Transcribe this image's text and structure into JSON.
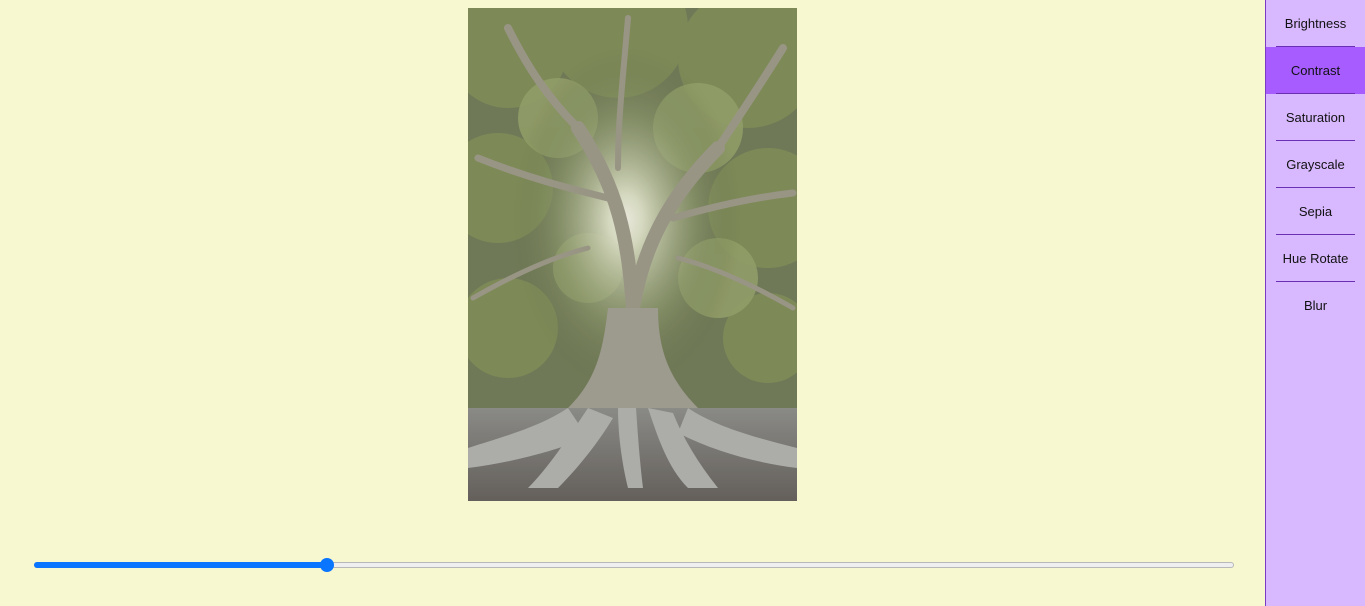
{
  "image": {
    "alt_description": "",
    "icon": "tree-photo"
  },
  "slider": {
    "value": 0.244,
    "accent_color": "#0a75ff"
  },
  "sidebar": {
    "active_index": 1,
    "items": [
      {
        "label": "Brightness"
      },
      {
        "label": "Contrast"
      },
      {
        "label": "Saturation"
      },
      {
        "label": "Grayscale"
      },
      {
        "label": "Sepia"
      },
      {
        "label": "Hue Rotate"
      },
      {
        "label": "Blur"
      }
    ],
    "colors": {
      "background": "#d8b8ff",
      "active": "#a65cff",
      "separator": "#6a2fb3"
    }
  },
  "page": {
    "background": "#f8f8d0"
  }
}
